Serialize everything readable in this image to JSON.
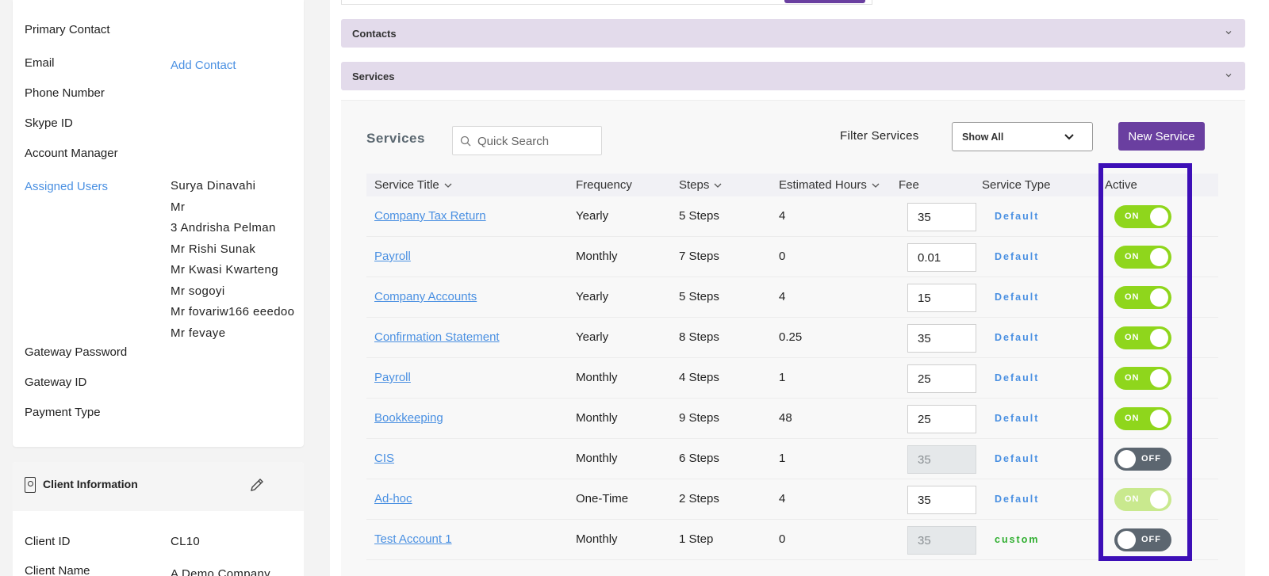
{
  "left_panel": {
    "primary_contact_label": "Primary Contact",
    "email_label": "Email",
    "add_contact_link": "Add Contact",
    "phone_label": "Phone Number",
    "skype_label": "Skype ID",
    "account_manager_label": "Account Manager",
    "assigned_users_label": "Assigned Users",
    "assigned_users": [
      "Surya Dinavahi",
      "Mr",
      "3 Andrisha Pelman",
      "Mr Rishi Sunak",
      "Mr Kwasi Kwarteng",
      "Mr sogoyi",
      "Mr fovariw166 eeedoo",
      "Mr fevaye"
    ],
    "gateway_password_label": "Gateway Password",
    "gateway_id_label": "Gateway ID",
    "payment_type_label": "Payment Type"
  },
  "client_info": {
    "title": "Client Information",
    "client_id_label": "Client ID",
    "client_id": "CL10",
    "client_name_label": "Client Name",
    "client_name": "A Demo Company"
  },
  "accordions": {
    "contacts": "Contacts",
    "services": "Services"
  },
  "services": {
    "title": "Services",
    "search_placeholder": "Quick Search",
    "filter_label": "Filter Services",
    "filter_value": "Show All",
    "new_button": "New Service",
    "columns": {
      "title": "Service Title",
      "frequency": "Frequency",
      "steps": "Steps",
      "hours": "Estimated Hours",
      "fee": "Fee",
      "type": "Service Type",
      "active": "Active"
    },
    "rows": [
      {
        "title": "Company Tax Return",
        "frequency": "Yearly",
        "steps": "5 Steps",
        "hours": "4",
        "fee": "35",
        "fee_disabled": false,
        "type": "Default",
        "active": "ON"
      },
      {
        "title": "Payroll",
        "frequency": "Monthly",
        "steps": "7 Steps",
        "hours": "0",
        "fee": "0.01",
        "fee_disabled": false,
        "type": "Default",
        "active": "ON"
      },
      {
        "title": "Company Accounts",
        "frequency": "Yearly",
        "steps": "5 Steps",
        "hours": "4",
        "fee": "15",
        "fee_disabled": false,
        "type": "Default",
        "active": "ON"
      },
      {
        "title": "Confirmation Statement",
        "frequency": "Yearly",
        "steps": "8 Steps",
        "hours": "0.25",
        "fee": "35",
        "fee_disabled": false,
        "type": "Default",
        "active": "ON"
      },
      {
        "title": "Payroll",
        "frequency": "Monthly",
        "steps": "4 Steps",
        "hours": "1",
        "fee": "25",
        "fee_disabled": false,
        "type": "Default",
        "active": "ON"
      },
      {
        "title": "Bookkeeping",
        "frequency": "Monthly",
        "steps": "9 Steps",
        "hours": "48",
        "fee": "25",
        "fee_disabled": false,
        "type": "Default",
        "active": "ON"
      },
      {
        "title": "CIS",
        "frequency": "Monthly",
        "steps": "6 Steps",
        "hours": "1",
        "fee": "35",
        "fee_disabled": true,
        "type": "Default",
        "active": "OFF"
      },
      {
        "title": "Ad-hoc",
        "frequency": "One-Time",
        "steps": "2 Steps",
        "hours": "4",
        "fee": "35",
        "fee_disabled": false,
        "type": "Default",
        "active": "ON",
        "faded": true
      },
      {
        "title": "Test Account 1",
        "frequency": "Monthly",
        "steps": "1 Step",
        "hours": "0",
        "fee": "35",
        "fee_disabled": true,
        "type": "custom",
        "active": "OFF"
      }
    ]
  },
  "colors": {
    "accent": "#6a3fa0",
    "link": "#4a90e2",
    "toggle_on": "#8fd61c",
    "toggle_off": "#5c6670",
    "highlight": "#3d0fb7",
    "custom_type": "#2fae2f"
  }
}
